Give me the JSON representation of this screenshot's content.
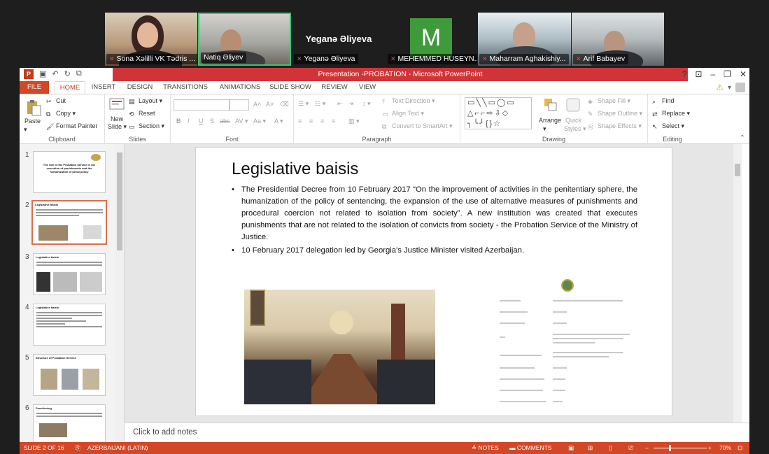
{
  "participants": [
    {
      "name": "Sona Xəlilli VK Tədris ...",
      "muted": true
    },
    {
      "name": "Natiq Əliyev",
      "muted": false
    },
    {
      "name": "Yeganə Əliyeva",
      "muted": true,
      "display_name": "Yeganə Əliyeva"
    },
    {
      "name": "MEHEMMED HUSEYN...",
      "muted": true,
      "avatar_letter": "M"
    },
    {
      "name": "Maharram Aghakishiy...",
      "muted": true
    },
    {
      "name": "Arif Babayev",
      "muted": true
    }
  ],
  "app": {
    "title": "Presentation -PROBATION - Microsoft PowerPoint",
    "logo_letter": "P"
  },
  "tabs": [
    "FILE",
    "HOME",
    "INSERT",
    "DESIGN",
    "TRANSITIONS",
    "ANIMATIONS",
    "SLIDE SHOW",
    "REVIEW",
    "VIEW"
  ],
  "ribbon": {
    "clipboard": {
      "paste": "Paste",
      "cut": "Cut",
      "copy": "Copy",
      "format_painter": "Format Painter",
      "label": "Clipboard"
    },
    "slides": {
      "new_slide_1": "New",
      "new_slide_2": "Slide",
      "layout": "Layout",
      "reset": "Reset",
      "section": "Section",
      "label": "Slides"
    },
    "font": {
      "label": "Font"
    },
    "paragraph": {
      "text_direction": "Text Direction",
      "align_text": "Align Text",
      "smartart": "Convert to SmartArt",
      "label": "Paragraph"
    },
    "drawing": {
      "arrange": "Arrange",
      "quick_1": "Quick",
      "quick_2": "Styles",
      "shape_fill": "Shape Fill",
      "shape_outline": "Shape Outline",
      "shape_effects": "Shape Effects",
      "label": "Drawing"
    },
    "editing": {
      "find": "Find",
      "replace": "Replace",
      "select": "Select",
      "label": "Editing"
    }
  },
  "thumbnails": [
    {
      "num": "1",
      "title": "The role of the Probation Service in the execution of punishments and the humanization of penal policy"
    },
    {
      "num": "2",
      "title": "Legislative baisis"
    },
    {
      "num": "3",
      "title": "Legislative baisis"
    },
    {
      "num": "4",
      "title": "Legislative baisis"
    },
    {
      "num": "5",
      "title": "Structure of Probation Service"
    },
    {
      "num": "6",
      "title": "Functioning"
    }
  ],
  "slide": {
    "title": "Legislative baisis",
    "bullets": [
      "The Presidential Decree from 10 February 2017 “On the improvement of activities in the penitentiary sphere, the humanization of the policy of sentencing, the expansion of the use of alternative measures of punishments and procedural coercion  not related to isolation from society”. A new institution was created that executes punishments that are not related to the isolation of convicts from society - the Probation Service of the Ministry of Justice.",
      "10 February 2017 delegation led by Georgia's Justice Minister visited Azerbaijan."
    ]
  },
  "notes_placeholder": "Click to add notes",
  "status": {
    "slide": "SLIDE 2 OF 16",
    "language": "AZERBAIJANI (LATIN)",
    "notes": "NOTES",
    "comments": "COMMENTS",
    "zoom": "70%"
  },
  "colors": {
    "accent": "#d24726",
    "title_bar": "#d13438",
    "active_speaker": "#3cc472",
    "avatar_bg": "#3e9a3a"
  }
}
